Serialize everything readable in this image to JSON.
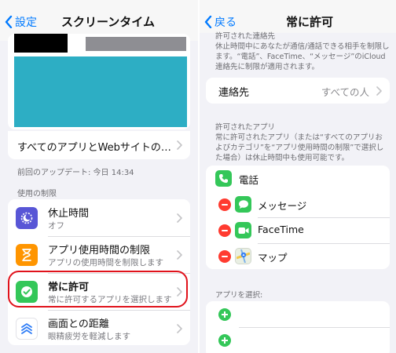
{
  "left": {
    "nav": {
      "back_label": "設定",
      "title": "スクリーンタイム"
    },
    "all_apps_label": "すべてのアプリとWebサイトの…",
    "last_update": "前回のアップデート: 今日 14:34",
    "limits_header": "使用の制限",
    "limits": [
      {
        "title": "休止時間",
        "subtitle": "オフ",
        "icon": "downtime-icon",
        "color": "#5856d6"
      },
      {
        "title": "アプリ使用時間の制限",
        "subtitle": "アプリの使用時間を制限します",
        "icon": "hourglass-icon",
        "color": "#ff9500"
      },
      {
        "title": "常に許可",
        "subtitle": "常に許可するアプリを選択します",
        "icon": "checkmark-icon",
        "color": "#34c759"
      },
      {
        "title": "画面との距離",
        "subtitle": "眼精疲労を軽減します",
        "icon": "screen-distance-icon",
        "color": "#ffffff"
      }
    ],
    "colors": {
      "chart_block": "#2daec4",
      "redact_dark": "#000000",
      "redact_gray": "#8e8e93",
      "highlight": "#e0121b"
    }
  },
  "right": {
    "nav": {
      "back_label": "戻る",
      "title": "常に許可"
    },
    "contacts_desc_header": "許可された連絡先",
    "contacts_desc": "休止時間中にあなたが通信/通話できる相手を制限します。“電話”、FaceTime、“メッセージ”のiCloud連絡先に制限が適用されます。",
    "contacts_row": {
      "label": "連絡先",
      "value": "すべての人"
    },
    "apps_desc_header": "許可されたアプリ",
    "apps_desc": "常に許可されたアプリ（または“すべてのアプリおよびカテゴリ”を“アプリ使用時間の制限”で選択した場合）は休止時間中も使用可能です。",
    "allowed_apps": [
      {
        "name": "電話",
        "icon": "phone-icon",
        "removable": false
      },
      {
        "name": "メッセージ",
        "icon": "messages-icon",
        "removable": true
      },
      {
        "name": "FaceTime",
        "icon": "facetime-icon",
        "removable": true
      },
      {
        "name": "マップ",
        "icon": "maps-icon",
        "removable": true
      }
    ],
    "choose_apps_header": "アプリを選択:"
  }
}
